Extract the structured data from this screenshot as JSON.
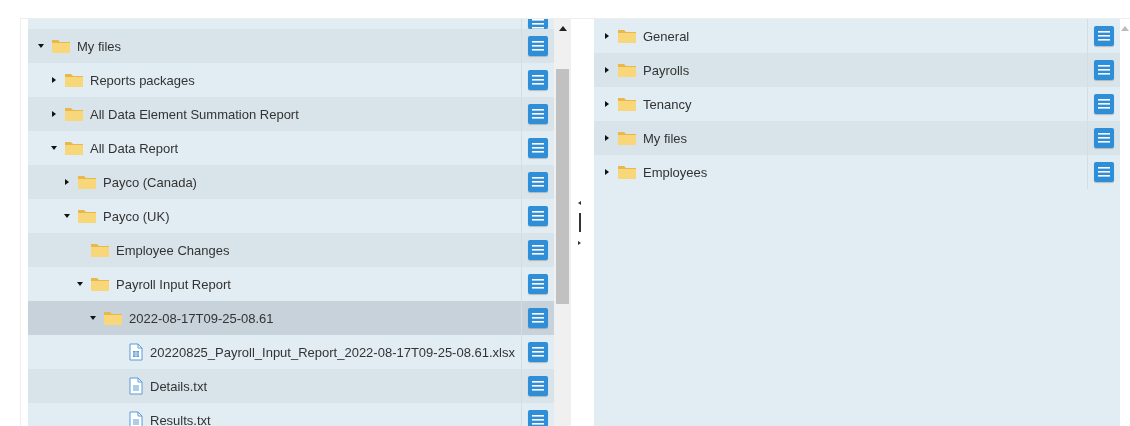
{
  "left_tree": {
    "items": [
      {
        "label": "My files",
        "kind": "folder",
        "expanded": true,
        "selected": false,
        "children": [
          {
            "label": "Reports packages",
            "kind": "folder",
            "expanded": false,
            "selected": false
          },
          {
            "label": "All Data Element Summation Report",
            "kind": "folder",
            "expanded": false,
            "selected": false
          },
          {
            "label": "All Data Report",
            "kind": "folder",
            "expanded": true,
            "selected": false,
            "children": [
              {
                "label": "Payco (Canada)",
                "kind": "folder",
                "expanded": false,
                "selected": false
              },
              {
                "label": "Payco (UK)",
                "kind": "folder",
                "expanded": true,
                "selected": false,
                "children": [
                  {
                    "label": "Employee Changes",
                    "kind": "leaf-folder",
                    "selected": false
                  },
                  {
                    "label": "Payroll Input Report",
                    "kind": "folder",
                    "expanded": true,
                    "selected": false,
                    "children": [
                      {
                        "label": "2022-08-17T09-25-08.61",
                        "kind": "folder",
                        "expanded": true,
                        "selected": true,
                        "children": [
                          {
                            "label": "20220825_Payroll_Input_Report_2022-08-17T09-25-08.61.xlsx",
                            "kind": "spreadsheet",
                            "selected": false
                          },
                          {
                            "label": "Details.txt",
                            "kind": "file",
                            "selected": false
                          },
                          {
                            "label": "Results.txt",
                            "kind": "file",
                            "selected": false
                          }
                        ]
                      }
                    ]
                  }
                ]
              }
            ]
          }
        ]
      }
    ]
  },
  "right_tree": {
    "items": [
      {
        "label": "General",
        "kind": "folder",
        "expanded": false,
        "selected": false
      },
      {
        "label": "Payrolls",
        "kind": "folder",
        "expanded": false,
        "selected": false
      },
      {
        "label": "Tenancy",
        "kind": "folder",
        "expanded": false,
        "selected": false
      },
      {
        "label": "My files",
        "kind": "folder",
        "expanded": false,
        "selected": false
      },
      {
        "label": "Employees",
        "kind": "folder",
        "expanded": false,
        "selected": false
      }
    ]
  }
}
